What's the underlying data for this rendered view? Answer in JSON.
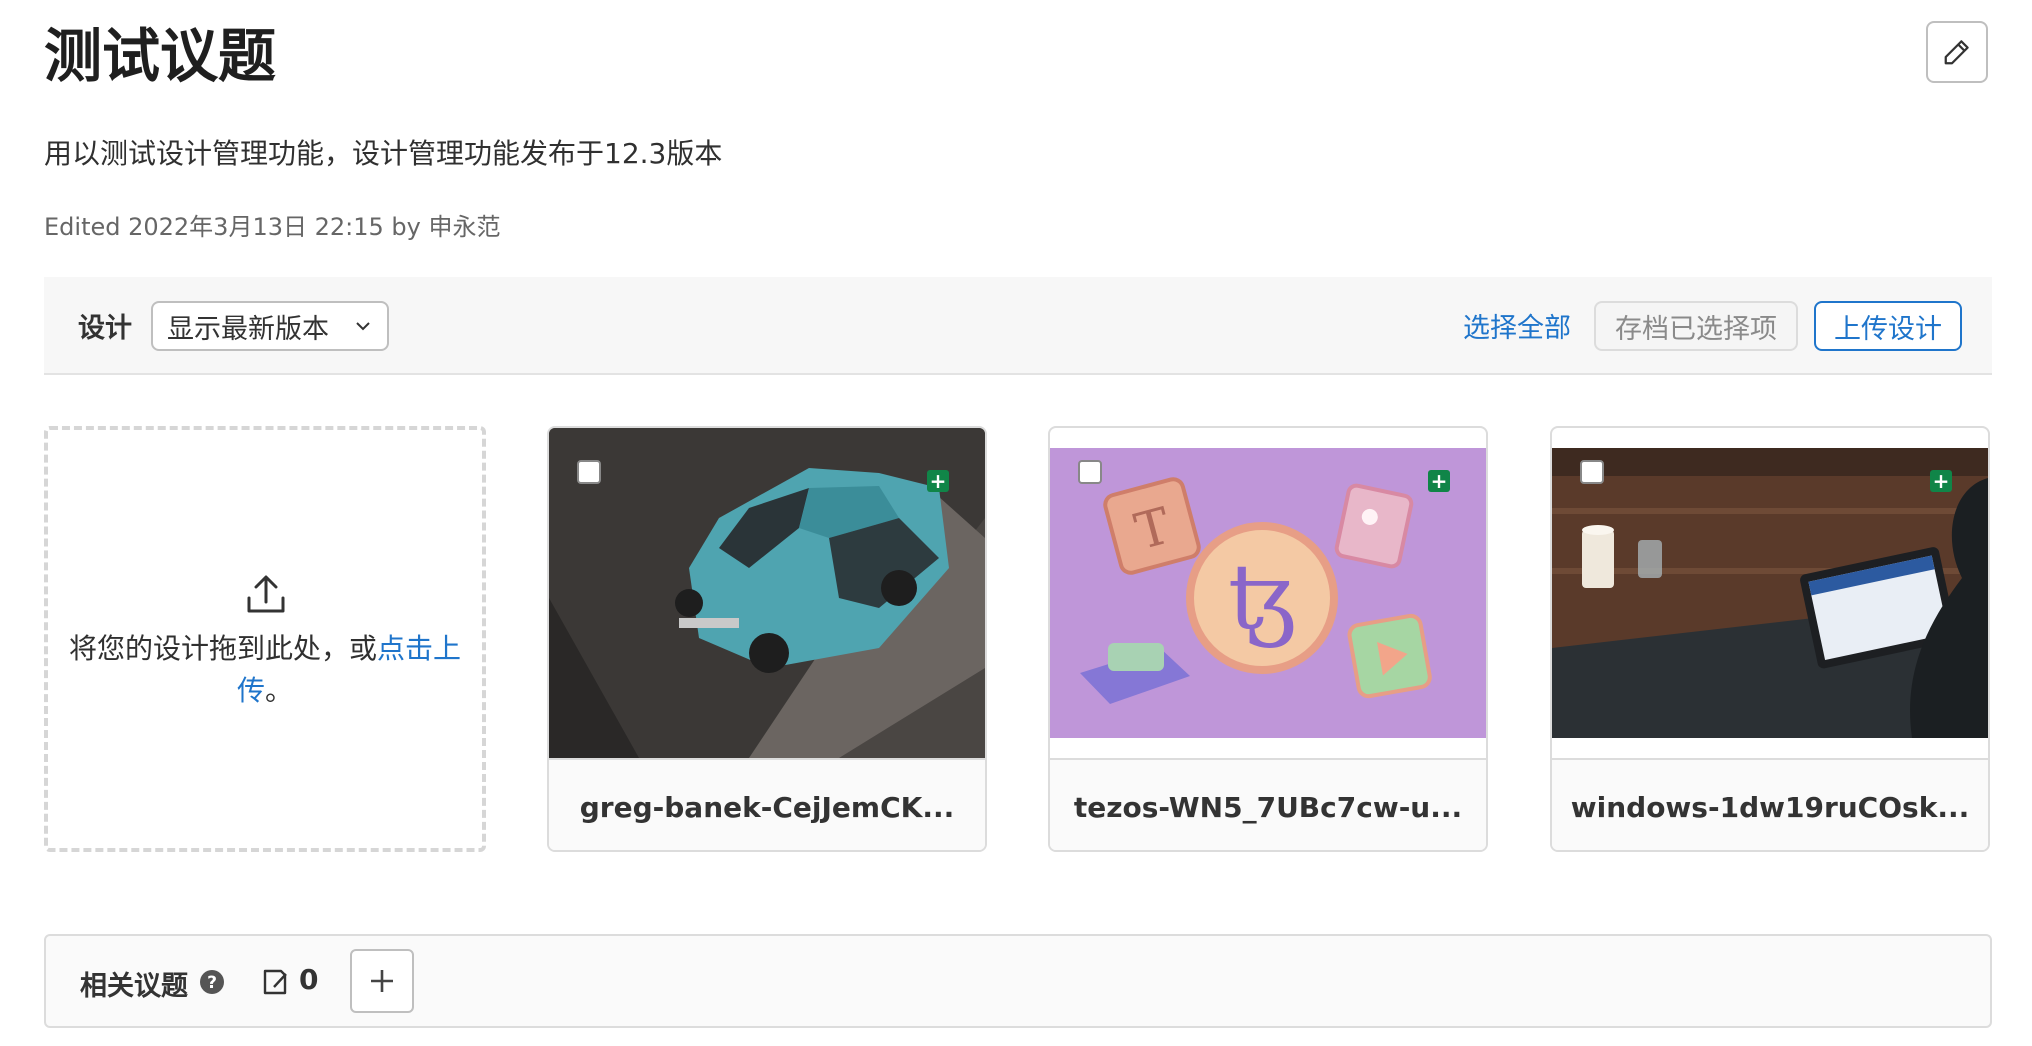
{
  "issue": {
    "title": "测试议题",
    "description": "用以测试设计管理功能，设计管理功能发布于12.3版本",
    "edited": "Edited 2022年3月13日 22:15 by 申永范"
  },
  "designs": {
    "label": "设计",
    "version_selected": "显示最新版本",
    "select_all": "选择全部",
    "archive_selected": "存档已选择项",
    "upload": "上传设计",
    "dropzone_text": "将您的设计拖到此处，或",
    "dropzone_link": "点击上传",
    "dropzone_suffix": "。",
    "items": [
      {
        "name": "greg-banek-CejJemCK..."
      },
      {
        "name": "tezos-WN5_7UBc7cw-u..."
      },
      {
        "name": "windows-1dw19ruCOsk..."
      }
    ]
  },
  "related": {
    "label": "相关议题",
    "count": "0",
    "add_symbol": "+"
  },
  "icons": {
    "edit": "pencil-icon",
    "dropdown": "chevron-down-icon",
    "upload": "upload-icon",
    "help": "question-circle-icon",
    "issues": "issues-icon",
    "add": "plus-icon",
    "new_design": "plus-square-icon"
  },
  "colors": {
    "link": "#1f75cb",
    "new_badge": "#108548",
    "border": "#dcdcdc"
  }
}
